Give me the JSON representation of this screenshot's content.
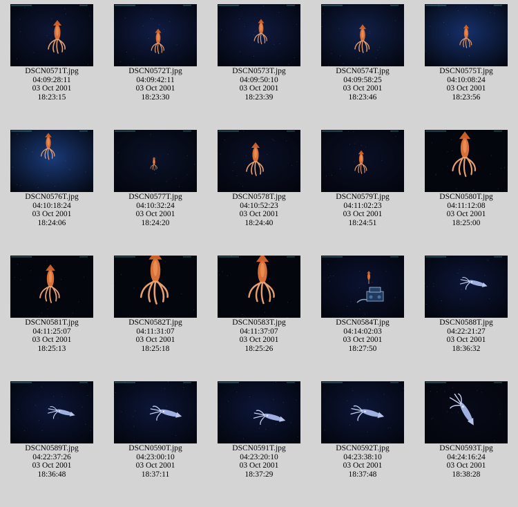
{
  "thumbnails": [
    {
      "filename": "DSCN0571T.jpg",
      "timecode": "04:09:28:11",
      "date": "03 Oct 2001",
      "time": "18:23:15"
    },
    {
      "filename": "DSCN0572T.jpg",
      "timecode": "04:09:42:11",
      "date": "03 Oct 2001",
      "time": "18:23:30"
    },
    {
      "filename": "DSCN0573T.jpg",
      "timecode": "04:09:50:10",
      "date": "03 Oct 2001",
      "time": "18:23:39"
    },
    {
      "filename": "DSCN0574T.jpg",
      "timecode": "04:09:58:25",
      "date": "03 Oct 2001",
      "time": "18:23:46"
    },
    {
      "filename": "DSCN0575T.jpg",
      "timecode": "04:10:08:24",
      "date": "03 Oct 2001",
      "time": "18:23:56"
    },
    {
      "filename": "DSCN0576T.jpg",
      "timecode": "04:10:18:24",
      "date": "03 Oct 2001",
      "time": "18:24:06"
    },
    {
      "filename": "DSCN0577T.jpg",
      "timecode": "04:10:32:24",
      "date": "03 Oct 2001",
      "time": "18:24:20"
    },
    {
      "filename": "DSCN0578T.jpg",
      "timecode": "04:10:52:23",
      "date": "03 Oct 2001",
      "time": "18:24:40"
    },
    {
      "filename": "DSCN0579T.jpg",
      "timecode": "04:11:02:23",
      "date": "03 Oct 2001",
      "time": "18:24:51"
    },
    {
      "filename": "DSCN0580T.jpg",
      "timecode": "04:11:12:08",
      "date": "03 Oct 2001",
      "time": "18:25:00"
    },
    {
      "filename": "DSCN0581T.jpg",
      "timecode": "04:11:25:07",
      "date": "03 Oct 2001",
      "time": "18:25:13"
    },
    {
      "filename": "DSCN0582T.jpg",
      "timecode": "04:11:31:07",
      "date": "03 Oct 2001",
      "time": "18:25:18"
    },
    {
      "filename": "DSCN0583T.jpg",
      "timecode": "04:11:37:07",
      "date": "03 Oct 2001",
      "time": "18:25:26"
    },
    {
      "filename": "DSCN0584T.jpg",
      "timecode": "04:14:02:03",
      "date": "03 Oct 2001",
      "time": "18:27:50"
    },
    {
      "filename": "DSCN0588T.jpg",
      "timecode": "04:22:21:27",
      "date": "03 Oct 2001",
      "time": "18:36:32"
    },
    {
      "filename": "DSCN0589T.jpg",
      "timecode": "04:22:37:26",
      "date": "03 Oct 2001",
      "time": "18:36:48"
    },
    {
      "filename": "DSCN0590T.jpg",
      "timecode": "04:23:00:10",
      "date": "03 Oct 2001",
      "time": "18:37:11"
    },
    {
      "filename": "DSCN0591T.jpg",
      "timecode": "04:23:20:10",
      "date": "03 Oct 2001",
      "time": "18:37:29"
    },
    {
      "filename": "DSCN0592T.jpg",
      "timecode": "04:23:38:10",
      "date": "03 Oct 2001",
      "time": "18:37:48"
    },
    {
      "filename": "DSCN0593T.jpg",
      "timecode": "04:24:16:24",
      "date": "03 Oct 2001",
      "time": "18:38:28"
    }
  ],
  "colors": {
    "page_background": "#d4d4d4",
    "deep_water": "#0c1430",
    "squid_orange": "#d9703a",
    "squid_pale": "#b8c4e8"
  }
}
